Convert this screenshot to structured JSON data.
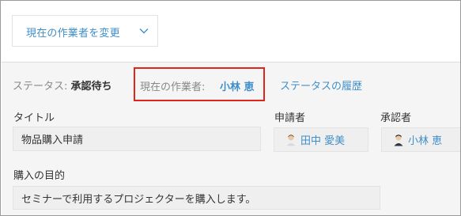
{
  "toolbar": {
    "change_assignee_label": "現在の作業者を変更"
  },
  "status": {
    "label": "ステータス:",
    "value": "承認待ち"
  },
  "assignee": {
    "label": "現在の作業者:",
    "name": "小林 恵"
  },
  "history_link": "ステータスの履歴",
  "fields": {
    "title": {
      "label": "タイトル",
      "value": "物品購入申請"
    },
    "applicant": {
      "label": "申請者",
      "name": "田中 愛美"
    },
    "approver": {
      "label": "承認者",
      "name": "小林 恵"
    },
    "purpose": {
      "label": "購入の目的",
      "value": "セミナーで利用するプロジェクターを購入します。"
    }
  },
  "colors": {
    "link": "#3f8fc9",
    "highlight": "#e0261c",
    "panel": "#f5f5f5"
  },
  "icons": [
    "chevron-down-icon",
    "user-avatar-icon"
  ]
}
